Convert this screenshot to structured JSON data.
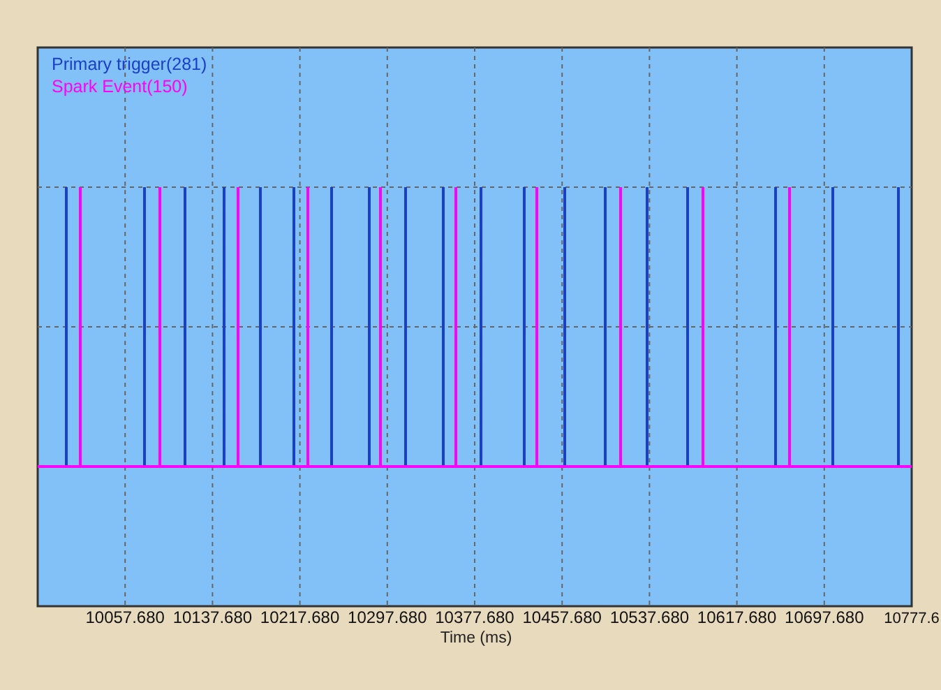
{
  "chart": {
    "legend": [
      {
        "label": "Primary trigger(281)",
        "color": "#1a3fc8"
      },
      {
        "label": "Spark Event(150)",
        "color": "#ff00ff"
      }
    ],
    "x_ticks": [
      "10057.680",
      "10137.680",
      "10217.680",
      "10297.680",
      "10377.680",
      "10457.680",
      "10537.680",
      "10617.680",
      "10697.680",
      "10777.6"
    ],
    "x_title": "Time (ms)"
  }
}
